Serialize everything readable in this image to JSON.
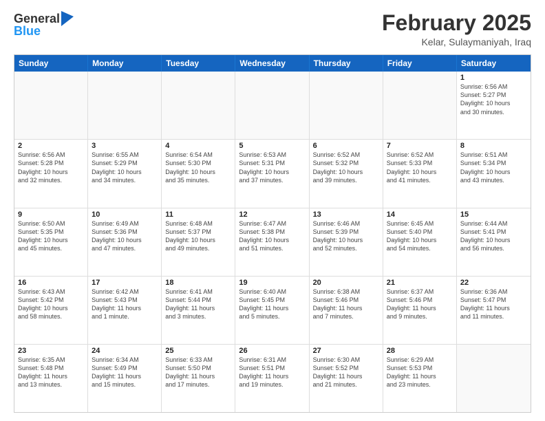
{
  "logo": {
    "general": "General",
    "blue": "Blue"
  },
  "header": {
    "title": "February 2025",
    "location": "Kelar, Sulaymaniyah, Iraq"
  },
  "weekdays": [
    "Sunday",
    "Monday",
    "Tuesday",
    "Wednesday",
    "Thursday",
    "Friday",
    "Saturday"
  ],
  "rows": [
    [
      {
        "day": "",
        "info": ""
      },
      {
        "day": "",
        "info": ""
      },
      {
        "day": "",
        "info": ""
      },
      {
        "day": "",
        "info": ""
      },
      {
        "day": "",
        "info": ""
      },
      {
        "day": "",
        "info": ""
      },
      {
        "day": "1",
        "info": "Sunrise: 6:56 AM\nSunset: 5:27 PM\nDaylight: 10 hours\nand 30 minutes."
      }
    ],
    [
      {
        "day": "2",
        "info": "Sunrise: 6:56 AM\nSunset: 5:28 PM\nDaylight: 10 hours\nand 32 minutes."
      },
      {
        "day": "3",
        "info": "Sunrise: 6:55 AM\nSunset: 5:29 PM\nDaylight: 10 hours\nand 34 minutes."
      },
      {
        "day": "4",
        "info": "Sunrise: 6:54 AM\nSunset: 5:30 PM\nDaylight: 10 hours\nand 35 minutes."
      },
      {
        "day": "5",
        "info": "Sunrise: 6:53 AM\nSunset: 5:31 PM\nDaylight: 10 hours\nand 37 minutes."
      },
      {
        "day": "6",
        "info": "Sunrise: 6:52 AM\nSunset: 5:32 PM\nDaylight: 10 hours\nand 39 minutes."
      },
      {
        "day": "7",
        "info": "Sunrise: 6:52 AM\nSunset: 5:33 PM\nDaylight: 10 hours\nand 41 minutes."
      },
      {
        "day": "8",
        "info": "Sunrise: 6:51 AM\nSunset: 5:34 PM\nDaylight: 10 hours\nand 43 minutes."
      }
    ],
    [
      {
        "day": "9",
        "info": "Sunrise: 6:50 AM\nSunset: 5:35 PM\nDaylight: 10 hours\nand 45 minutes."
      },
      {
        "day": "10",
        "info": "Sunrise: 6:49 AM\nSunset: 5:36 PM\nDaylight: 10 hours\nand 47 minutes."
      },
      {
        "day": "11",
        "info": "Sunrise: 6:48 AM\nSunset: 5:37 PM\nDaylight: 10 hours\nand 49 minutes."
      },
      {
        "day": "12",
        "info": "Sunrise: 6:47 AM\nSunset: 5:38 PM\nDaylight: 10 hours\nand 51 minutes."
      },
      {
        "day": "13",
        "info": "Sunrise: 6:46 AM\nSunset: 5:39 PM\nDaylight: 10 hours\nand 52 minutes."
      },
      {
        "day": "14",
        "info": "Sunrise: 6:45 AM\nSunset: 5:40 PM\nDaylight: 10 hours\nand 54 minutes."
      },
      {
        "day": "15",
        "info": "Sunrise: 6:44 AM\nSunset: 5:41 PM\nDaylight: 10 hours\nand 56 minutes."
      }
    ],
    [
      {
        "day": "16",
        "info": "Sunrise: 6:43 AM\nSunset: 5:42 PM\nDaylight: 10 hours\nand 58 minutes."
      },
      {
        "day": "17",
        "info": "Sunrise: 6:42 AM\nSunset: 5:43 PM\nDaylight: 11 hours\nand 1 minute."
      },
      {
        "day": "18",
        "info": "Sunrise: 6:41 AM\nSunset: 5:44 PM\nDaylight: 11 hours\nand 3 minutes."
      },
      {
        "day": "19",
        "info": "Sunrise: 6:40 AM\nSunset: 5:45 PM\nDaylight: 11 hours\nand 5 minutes."
      },
      {
        "day": "20",
        "info": "Sunrise: 6:38 AM\nSunset: 5:46 PM\nDaylight: 11 hours\nand 7 minutes."
      },
      {
        "day": "21",
        "info": "Sunrise: 6:37 AM\nSunset: 5:46 PM\nDaylight: 11 hours\nand 9 minutes."
      },
      {
        "day": "22",
        "info": "Sunrise: 6:36 AM\nSunset: 5:47 PM\nDaylight: 11 hours\nand 11 minutes."
      }
    ],
    [
      {
        "day": "23",
        "info": "Sunrise: 6:35 AM\nSunset: 5:48 PM\nDaylight: 11 hours\nand 13 minutes."
      },
      {
        "day": "24",
        "info": "Sunrise: 6:34 AM\nSunset: 5:49 PM\nDaylight: 11 hours\nand 15 minutes."
      },
      {
        "day": "25",
        "info": "Sunrise: 6:33 AM\nSunset: 5:50 PM\nDaylight: 11 hours\nand 17 minutes."
      },
      {
        "day": "26",
        "info": "Sunrise: 6:31 AM\nSunset: 5:51 PM\nDaylight: 11 hours\nand 19 minutes."
      },
      {
        "day": "27",
        "info": "Sunrise: 6:30 AM\nSunset: 5:52 PM\nDaylight: 11 hours\nand 21 minutes."
      },
      {
        "day": "28",
        "info": "Sunrise: 6:29 AM\nSunset: 5:53 PM\nDaylight: 11 hours\nand 23 minutes."
      },
      {
        "day": "",
        "info": ""
      }
    ]
  ]
}
